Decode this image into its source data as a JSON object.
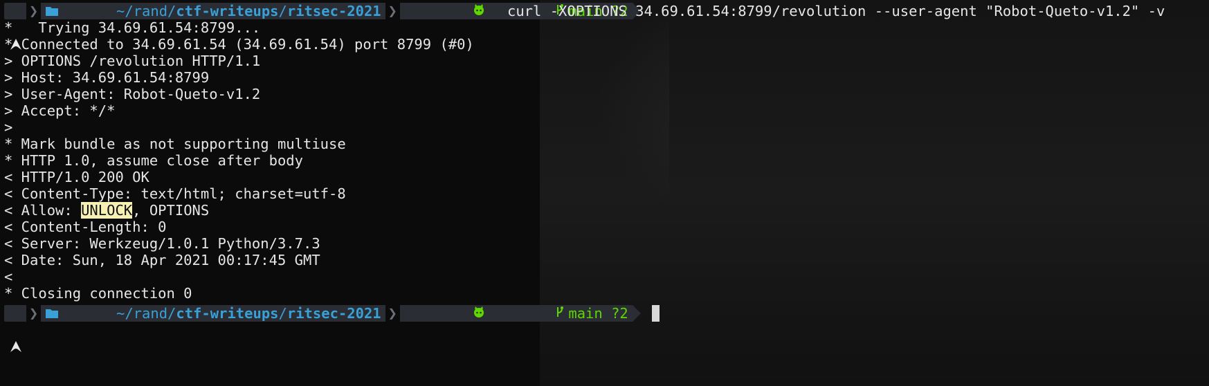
{
  "prompt": {
    "path_prefix": "~/rand/",
    "path_bold": "ctf-writeups",
    "path_sep": "/",
    "path_tail": "ritsec-2021",
    "git_branch": "main",
    "git_status": "?2"
  },
  "command": "curl -XOPTIONS 34.69.61.54:8799/revolution --user-agent \"Robot-Queto-v1.2\" -v",
  "output": [
    "*   Trying 34.69.61.54:8799...",
    "* Connected to 34.69.61.54 (34.69.61.54) port 8799 (#0)",
    "> OPTIONS /revolution HTTP/1.1",
    "> Host: 34.69.61.54:8799",
    "> User-Agent: Robot-Queto-v1.2",
    "> Accept: */*",
    ">",
    "* Mark bundle as not supporting multiuse",
    "* HTTP 1.0, assume close after body",
    "< HTTP/1.0 200 OK",
    "< Content-Type: text/html; charset=utf-8"
  ],
  "allow_line": {
    "prefix": "< Allow: ",
    "highlight": "UNLOCK",
    "suffix": ", OPTIONS"
  },
  "output2": [
    "< Content-Length: 0",
    "< Server: Werkzeug/1.0.1 Python/3.7.3",
    "< Date: Sun, 18 Apr 2021 00:17:45 GMT",
    "<",
    "* Closing connection 0"
  ],
  "colors": {
    "background": "#0b0b0b",
    "path": "#39a0d8",
    "git": "#5fd700",
    "highlight": "#f6f0b5",
    "prompt_segment": "#2a2d33"
  },
  "icons": [
    "arch-linux-icon",
    "folder-icon",
    "github-icon",
    "git-branch-icon"
  ]
}
